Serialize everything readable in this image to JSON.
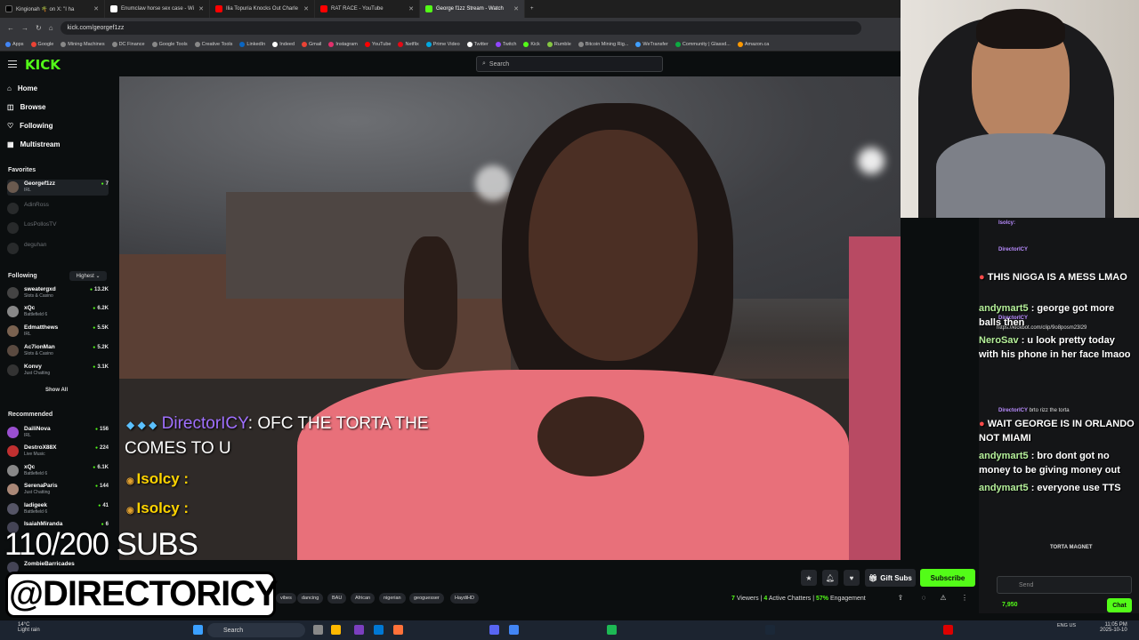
{
  "tabs": [
    {
      "label": "Kingionah 🌴 on X: \"I ha",
      "color": "#000000"
    },
    {
      "label": "Enumclaw horse sex case - Wi",
      "color": "#ffffff"
    },
    {
      "label": "Ilia Topuria Knocks Out Charle",
      "color": "#ff0000"
    },
    {
      "label": "RAT RACE - YouTube",
      "color": "#ff0000"
    },
    {
      "label": "George f1zz Stream - Watch",
      "color": "#53fc18"
    }
  ],
  "url": "kick.com/georgef1zz",
  "bookmarks": [
    "Apps",
    "Google",
    "Mining Machines",
    "DC Finance",
    "Google Tools",
    "Creative Tools",
    "LinkedIn",
    "Indeed",
    "Gmail",
    "Instagram",
    "YouTube",
    "Netflix",
    "Prime Video",
    "Twitter",
    "Twitch",
    "Kick",
    "Rumble",
    "Bitcoin Mining Rig...",
    "WeTransfer",
    "Community | Glassd...",
    "Amazon.ca"
  ],
  "brand": {
    "logo": "KICK",
    "accent": "#53fc18"
  },
  "search_placeholder": "Search",
  "nav": [
    "Home",
    "Browse",
    "Following",
    "Multistream"
  ],
  "favorites_title": "Favorites",
  "favorites": [
    {
      "name": "Georgef1zz",
      "cat": "IRL",
      "viewers": "7",
      "live": true
    },
    {
      "name": "AdinRoss",
      "cat": "",
      "viewers": "",
      "live": false
    },
    {
      "name": "LosPollosTV",
      "cat": "",
      "viewers": "",
      "live": false
    },
    {
      "name": "deguhan",
      "cat": "",
      "viewers": "",
      "live": false
    }
  ],
  "following_title": "Following",
  "sort_label": "Highest",
  "following": [
    {
      "name": "sweatergxd",
      "cat": "Slots & Casino",
      "viewers": "13.2K"
    },
    {
      "name": "xQc",
      "cat": "Battlefield 6",
      "viewers": "6.2K"
    },
    {
      "name": "Edmatthews",
      "cat": "IRL",
      "viewers": "5.5K"
    },
    {
      "name": "Ac7ionMan",
      "cat": "Slots & Casino",
      "viewers": "5.2K"
    },
    {
      "name": "Konvy",
      "cat": "Just Chatting",
      "viewers": "3.1K"
    }
  ],
  "show_all": "Show All",
  "recommended_title": "Recommended",
  "recommended": [
    {
      "name": "DailiNova",
      "cat": "IRL",
      "viewers": "156"
    },
    {
      "name": "DestroX88X",
      "cat": "Live Music",
      "viewers": "224"
    },
    {
      "name": "xQc",
      "cat": "Battlefield 6",
      "viewers": "6.1K"
    },
    {
      "name": "SerenaParis",
      "cat": "Just Chatting",
      "viewers": "144"
    },
    {
      "name": "ladigeek",
      "cat": "Battlefield 6",
      "viewers": "41"
    },
    {
      "name": "IsaiahMiranda",
      "cat": "",
      "viewers": "6"
    },
    {
      "name": "ZombieBarricades",
      "cat": "",
      "viewers": ""
    }
  ],
  "video_overlay": {
    "user": "DirectorICY",
    "message": ": OFC THE TORTA THE",
    "message2": "COMES TO U",
    "names": [
      "Isolcy :",
      "Isolcy :"
    ]
  },
  "tags": [
    "vibes",
    "dancing",
    "BAU",
    "African",
    "nigerian",
    "geoguesser",
    "HaydiHD"
  ],
  "actions": {
    "gift": "Gift Subs",
    "subscribe": "Subscribe"
  },
  "stats": {
    "viewers": "7",
    "viewers_label": "Viewers",
    "chatters": "4",
    "chatters_label": "Active Chatters",
    "engagement": "57%",
    "engagement_label": "Engagement"
  },
  "chat": {
    "messages": [
      {
        "user": "",
        "text": "THIS NIGGA IS A MESS LMAO"
      },
      {
        "user": "andymart5",
        "text": " : george got more balls then"
      },
      {
        "user": "NeroSav",
        "text": " : u look pretty today with his phone in her face lmaoo"
      },
      {
        "user": "",
        "text": "WAIT GEORGE IS IN ORLANDO NOT MIAMI"
      },
      {
        "user": "andymart5",
        "text": " : bro dont got no money to be giving money out"
      },
      {
        "user": "andymart5",
        "text": " : everyone use TTS"
      }
    ],
    "small": [
      {
        "user": "Isolcy:",
        "text": ""
      },
      {
        "user": "DirectorICY",
        "text": ""
      },
      {
        "user": "DirectorICY",
        "text": "https://kickbot.com/clip/9o8posm23l29"
      },
      {
        "user": "DirectorICY",
        "text": "brto rizz the torta"
      },
      {
        "user": "",
        "text": "TORTA MAGNET"
      }
    ],
    "input_placeholder": "Send",
    "points": "7,950",
    "chat_button": "Chat"
  },
  "overlay": {
    "subs": "110/200 SUBS",
    "handle": "@DIRECTORICY"
  },
  "taskbar": {
    "weather": "14°C",
    "weather_sub": "Light rain",
    "search": "Search",
    "lang": "ENG US",
    "time": "11:05 PM",
    "date": "2025-10-10"
  }
}
